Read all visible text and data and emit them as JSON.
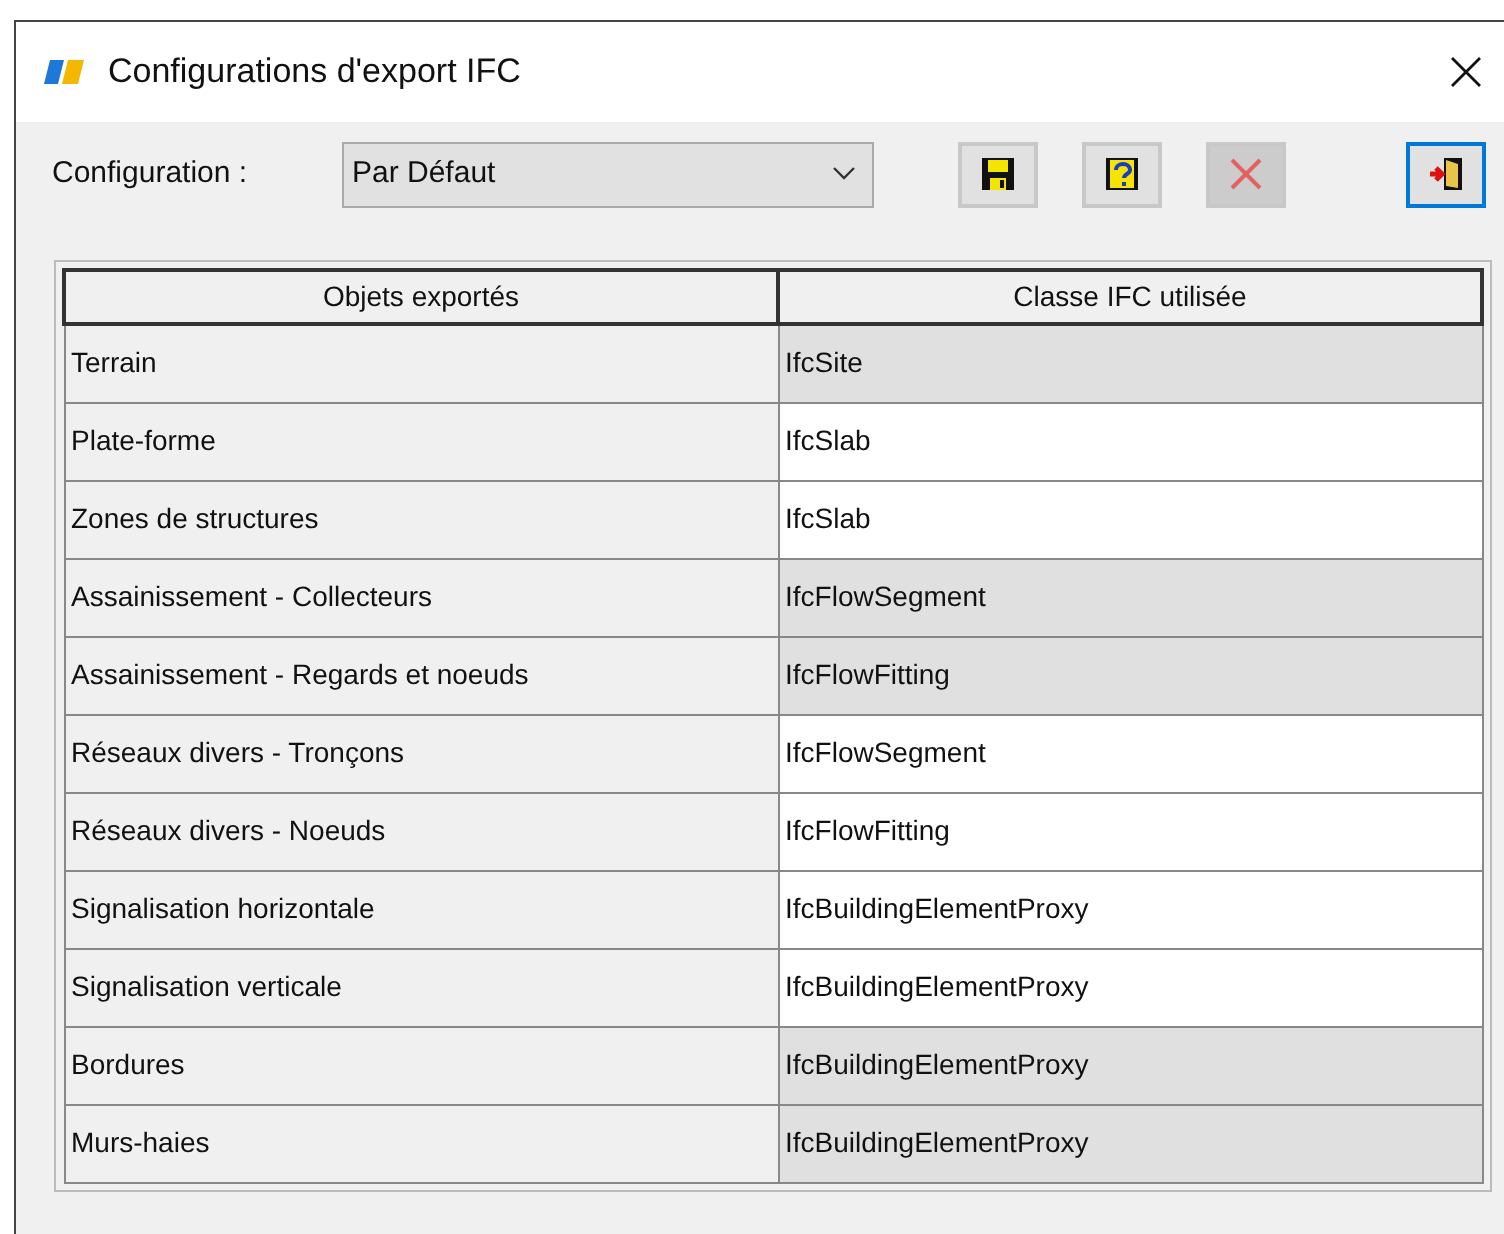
{
  "window": {
    "title": "Configurations d'export IFC"
  },
  "toolbar": {
    "label": "Configuration :",
    "dropdown": {
      "value": "Par Défaut"
    },
    "buttons": [
      {
        "kind": "save",
        "disabled": false,
        "focused": false
      },
      {
        "kind": "help",
        "disabled": false,
        "focused": false
      },
      {
        "kind": "delete",
        "disabled": true,
        "focused": false
      },
      {
        "kind": "exit",
        "disabled": false,
        "focused": true
      }
    ]
  },
  "table": {
    "columns": [
      "Objets exportés",
      "Classe IFC utilisée"
    ],
    "rows": [
      {
        "object": "Terrain",
        "ifc_class": "IfcSite",
        "shaded": true
      },
      {
        "object": "Plate-forme",
        "ifc_class": "IfcSlab",
        "shaded": false
      },
      {
        "object": "Zones de structures",
        "ifc_class": "IfcSlab",
        "shaded": false
      },
      {
        "object": "Assainissement - Collecteurs",
        "ifc_class": "IfcFlowSegment",
        "shaded": true
      },
      {
        "object": "Assainissement - Regards et noeuds",
        "ifc_class": "IfcFlowFitting",
        "shaded": true
      },
      {
        "object": "Réseaux divers - Tronçons",
        "ifc_class": "IfcFlowSegment",
        "shaded": false
      },
      {
        "object": "Réseaux divers - Noeuds",
        "ifc_class": "IfcFlowFitting",
        "shaded": false
      },
      {
        "object": "Signalisation horizontale",
        "ifc_class": "IfcBuildingElementProxy",
        "shaded": false
      },
      {
        "object": "Signalisation verticale",
        "ifc_class": "IfcBuildingElementProxy",
        "shaded": false
      },
      {
        "object": "Bordures",
        "ifc_class": "IfcBuildingElementProxy",
        "shaded": true
      },
      {
        "object": "Murs-haies",
        "ifc_class": "IfcBuildingElementProxy",
        "shaded": true
      }
    ]
  }
}
